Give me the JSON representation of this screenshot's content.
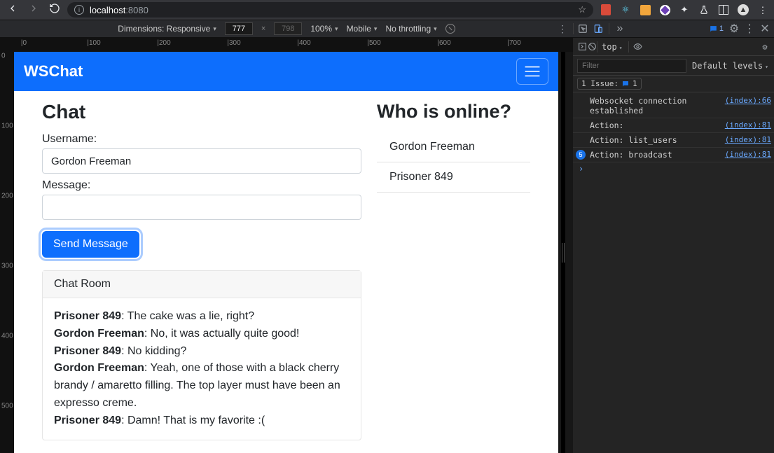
{
  "browser": {
    "url_host": "localhost",
    "url_port": ":8080",
    "star": "☆"
  },
  "device_toolbar": {
    "dimensions_label": "Dimensions: Responsive",
    "width": "777",
    "height": "798",
    "zoom": "100%",
    "device_type": "Mobile",
    "throttling": "No throttling"
  },
  "ruler_h": [
    "0",
    "100",
    "200",
    "300",
    "400",
    "500",
    "600",
    "700"
  ],
  "ruler_v": [
    "0",
    "100",
    "200",
    "300",
    "400",
    "500"
  ],
  "app": {
    "brand": "WSChat",
    "chat_heading": "Chat",
    "online_heading": "Who is online?",
    "username_label": "Username:",
    "username_value": "Gordon Freeman",
    "message_label": "Message:",
    "message_value": "",
    "send_label": "Send Message",
    "chatroom_header": "Chat Room",
    "messages": [
      {
        "author": "Prisoner 849",
        "text": ": The cake was a lie, right?"
      },
      {
        "author": "Gordon Freeman",
        "text": ": No, it was actually quite good!"
      },
      {
        "author": "Prisoner 849",
        "text": ": No kidding?"
      },
      {
        "author": "Gordon Freeman",
        "text": ": Yeah, one of those with a black cherry brandy / amaretto filling. The top layer must have been an expresso creme."
      },
      {
        "author": "Prisoner 849",
        "text": ": Damn! That is my favorite :("
      }
    ],
    "online_users": [
      "Gordon Freeman",
      "Prisoner 849"
    ]
  },
  "devtools": {
    "msg_badge_count": "1",
    "top_label": "top",
    "filter_placeholder": "Filter",
    "levels_label": "Default levels",
    "issues_label": "1 Issue:",
    "issues_count": "1",
    "logs": [
      {
        "badge": "",
        "text": "Websocket connection established",
        "src": "(index):66"
      },
      {
        "badge": "",
        "text": "Action:",
        "src": "(index):81"
      },
      {
        "badge": "",
        "text": "Action: list_users",
        "src": "(index):81"
      },
      {
        "badge": "5",
        "text": "Action: broadcast",
        "src": "(index):81"
      }
    ]
  }
}
